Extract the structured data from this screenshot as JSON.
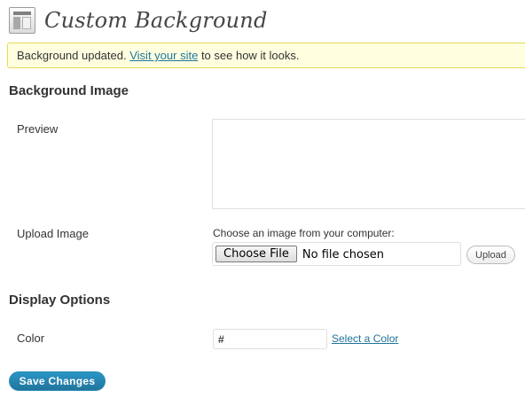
{
  "header": {
    "title": "Custom Background",
    "icon": "appearance-icon"
  },
  "notice": {
    "text_before": "Background updated.",
    "link_text": "Visit your site",
    "text_after": "to see how it looks."
  },
  "background_image": {
    "heading": "Background Image",
    "preview_label": "Preview",
    "upload_label": "Upload Image",
    "upload_hint": "Choose an image from your computer:",
    "choose_file_label": "Choose File",
    "no_file_text": "No file chosen",
    "upload_button_label": "Upload"
  },
  "display_options": {
    "heading": "Display Options",
    "color_label": "Color",
    "color_value": "#",
    "select_color_label": "Select a Color"
  },
  "actions": {
    "save_label": "Save Changes"
  },
  "colors": {
    "link": "#21759b",
    "notice_bg": "#ffffe0",
    "notice_border": "#e6db55",
    "primary_button": "#21759b"
  }
}
